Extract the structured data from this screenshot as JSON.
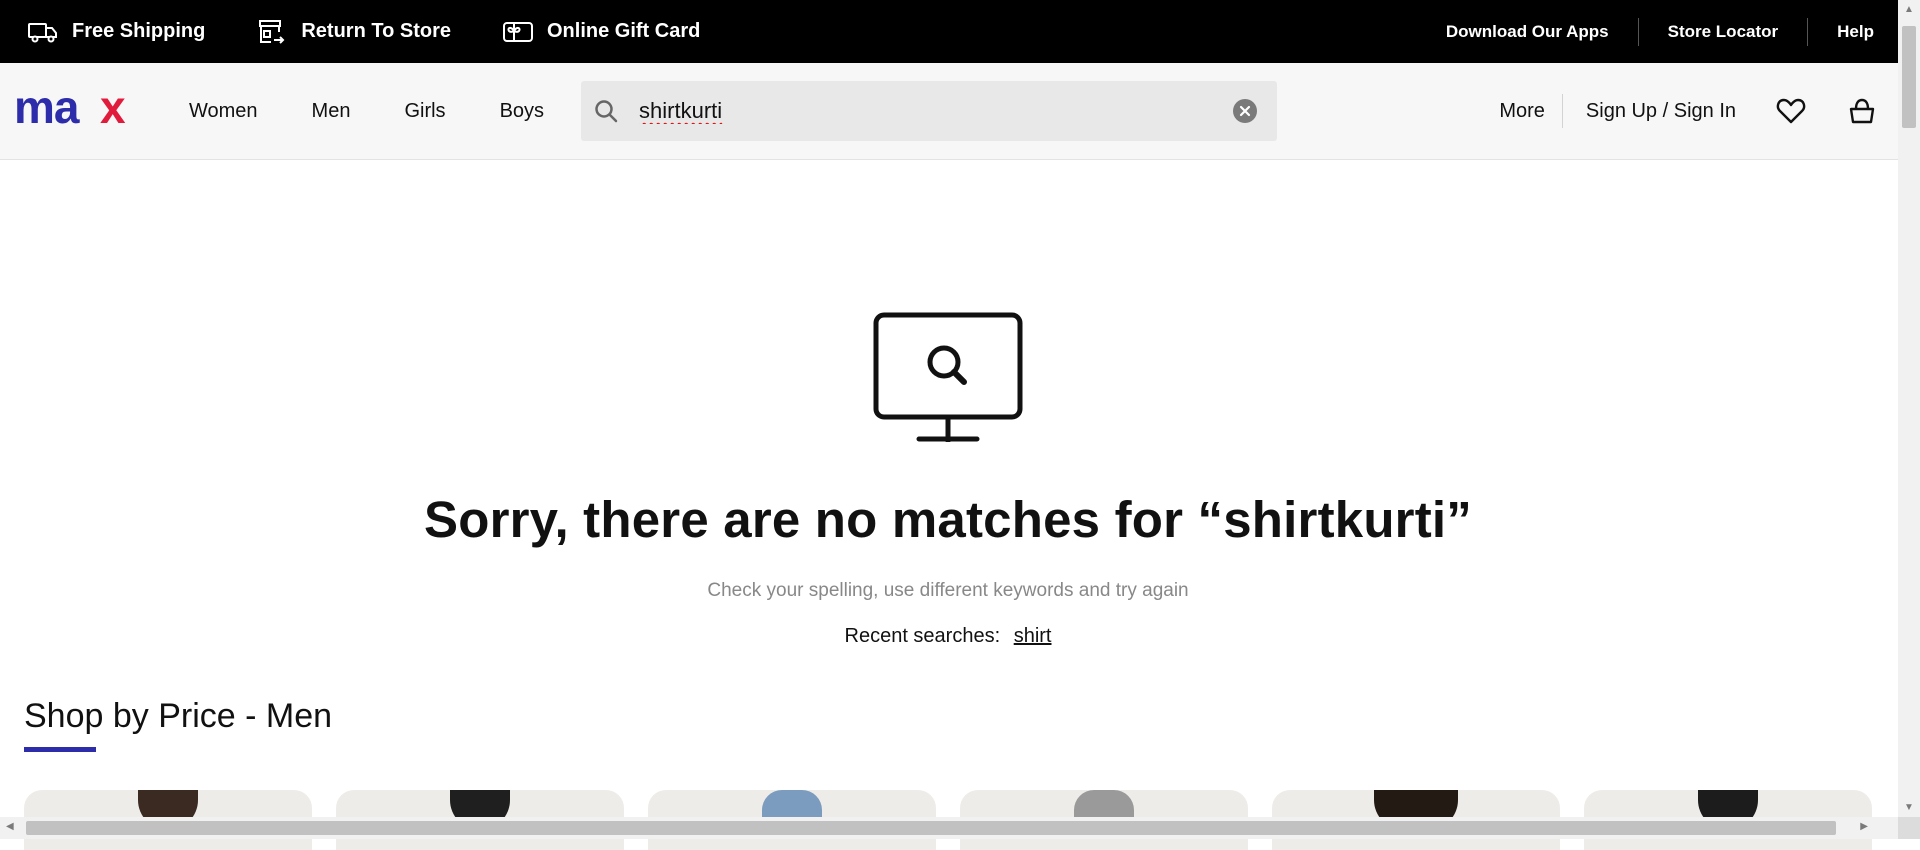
{
  "topbar": {
    "promos": [
      {
        "label": "Free Shipping",
        "icon": "truck-icon"
      },
      {
        "label": "Return To Store",
        "icon": "return-store-icon"
      },
      {
        "label": "Online Gift Card",
        "icon": "gift-card-icon"
      }
    ],
    "utility_links": [
      "Download Our Apps",
      "Store Locator",
      "Help"
    ]
  },
  "header": {
    "logo": "max",
    "logo_colors": {
      "m": "#2d2dab",
      "a": "#2d2dab",
      "x": "#e11b3b"
    },
    "nav": [
      "Women",
      "Men",
      "Girls",
      "Boys"
    ],
    "search": {
      "value": "shirtkurti"
    },
    "more_label": "More",
    "signin_label": "Sign Up / Sign In"
  },
  "main": {
    "no_match_text": "Sorry, there are no matches for “shirtkurti”",
    "hint_text": "Check your spelling, use different keywords and try again",
    "recent_label": "Recent searches:",
    "recent_terms": [
      "shirt"
    ],
    "section_title": "Shop by Price - Men",
    "accent_color": "#2d2dab"
  }
}
